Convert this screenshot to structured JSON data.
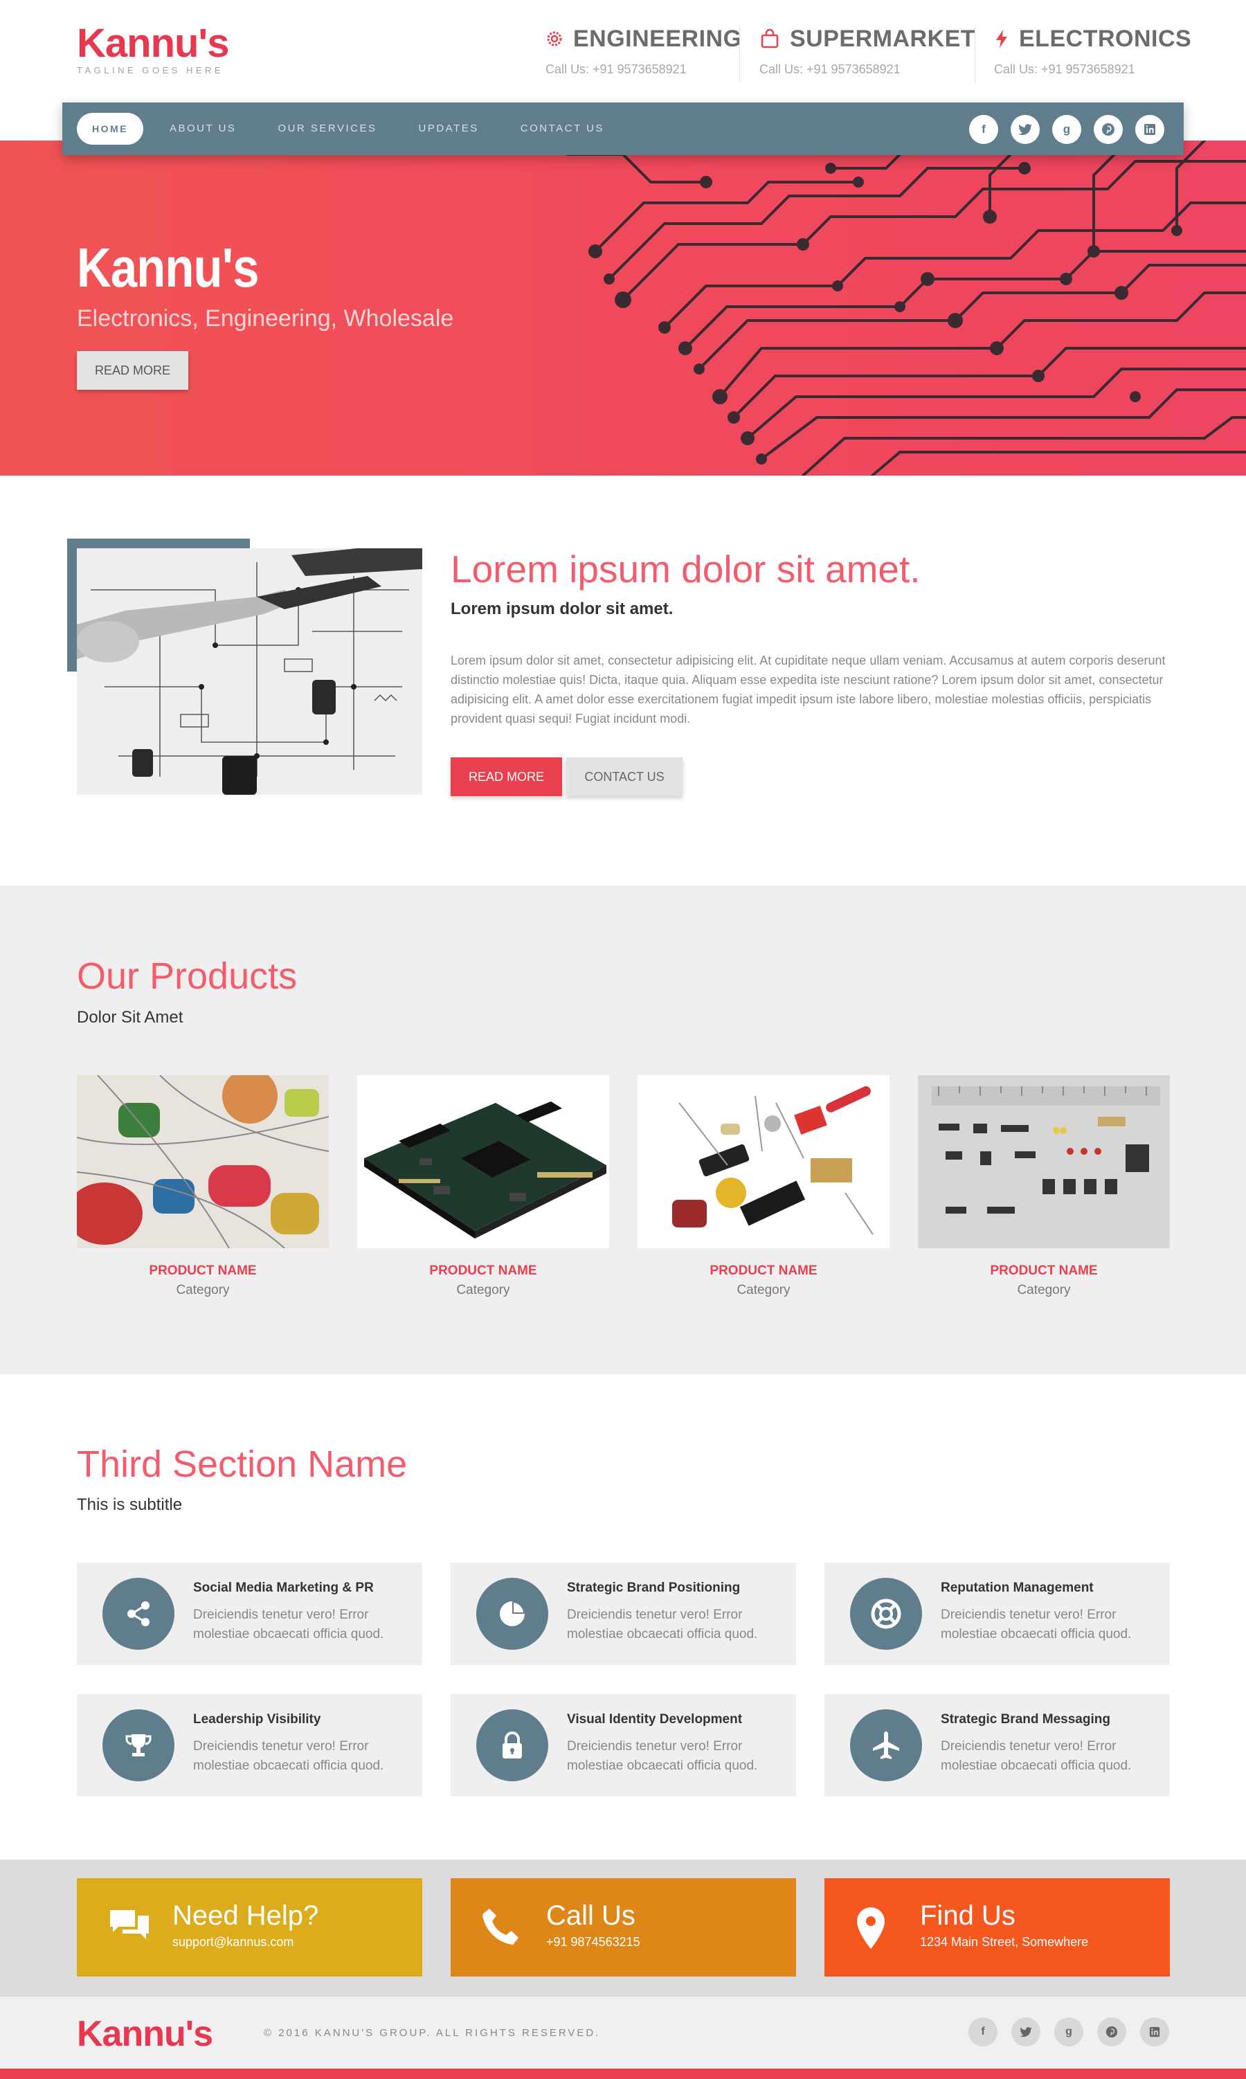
{
  "brand": {
    "logo": "Kannu's",
    "tagline": "TAGLINE GOES HERE"
  },
  "header_blocks": [
    {
      "title": "ENGINEERING",
      "phone": "Call Us: +91 9573658921",
      "icon": "gear-icon"
    },
    {
      "title": "SUPERMARKET",
      "phone": "Call Us: +91 9573658921",
      "icon": "shopping-bag-icon"
    },
    {
      "title": "ELECTRONICS",
      "phone": "Call Us: +91 9573658921",
      "icon": "lightning-icon"
    }
  ],
  "nav": {
    "items": [
      "HOME",
      "ABOUT US",
      "OUR SERVICES",
      "UPDATES",
      "CONTACT US"
    ],
    "social": [
      "f",
      "t",
      "g",
      "p",
      "in"
    ]
  },
  "hero": {
    "title": "Kannu's",
    "subtitle": "Electronics, Engineering, Wholesale",
    "button": "READ MORE"
  },
  "about": {
    "heading": "Lorem ipsum dolor sit amet.",
    "subheading": "Lorem ipsum dolor sit amet.",
    "body": "Lorem ipsum dolor sit amet, consectetur adipisicing elit. At cupiditate neque ullam veniam. Accusamus at autem corporis deserunt distinctio molestiae quis! Dicta, itaque quia. Aliquam esse expedita iste nesciunt ratione? Lorem ipsum dolor sit amet, consectetur adipisicing elit. A amet dolor esse exercitationem fugiat impedit ipsum iste labore libero, molestiae molestias officiis, perspiciatis provident quasi sequi! Fugiat incidunt modi.",
    "read_more": "READ MORE",
    "contact_us": "CONTACT US"
  },
  "products": {
    "title": "Our Products",
    "subtitle": "Dolor Sit Amet",
    "items": [
      {
        "name": "PRODUCT NAME",
        "category": "Category"
      },
      {
        "name": "PRODUCT NAME",
        "category": "Category"
      },
      {
        "name": "PRODUCT NAME",
        "category": "Category"
      },
      {
        "name": "PRODUCT NAME",
        "category": "Category"
      }
    ]
  },
  "services": {
    "title": "Third Section Name",
    "subtitle": "This is subtitle",
    "items": [
      {
        "title": "Social Media Marketing & PR",
        "desc": "Dreiciendis tenetur vero! Error molestiae obcaecati officia quod.",
        "icon": "share-icon"
      },
      {
        "title": "Strategic Brand Positioning",
        "desc": "Dreiciendis tenetur vero! Error molestiae obcaecati officia quod.",
        "icon": "pie-chart-icon"
      },
      {
        "title": "Reputation Management",
        "desc": "Dreiciendis tenetur vero! Error molestiae obcaecati officia quod.",
        "icon": "lifebuoy-icon"
      },
      {
        "title": "Leadership Visibility",
        "desc": "Dreiciendis tenetur vero! Error molestiae obcaecati officia quod.",
        "icon": "trophy-icon"
      },
      {
        "title": "Visual Identity Development",
        "desc": "Dreiciendis tenetur vero! Error molestiae obcaecati officia quod.",
        "icon": "lock-icon"
      },
      {
        "title": "Strategic Brand Messaging",
        "desc": "Dreiciendis tenetur vero! Error molestiae obcaecati officia quod.",
        "icon": "airplane-icon"
      }
    ]
  },
  "contact": [
    {
      "title": "Need Help?",
      "sub": "support@kannus.com",
      "icon": "chat-icon",
      "color": "#dcac1c"
    },
    {
      "title": "Call Us",
      "sub": "+91 9874563215",
      "icon": "phone-icon",
      "color": "#df8618"
    },
    {
      "title": "Find Us",
      "sub": "1234 Main Street, Somewhere",
      "icon": "map-pin-icon",
      "color": "#f5571f"
    }
  ],
  "footer": {
    "logo": "Kannu's",
    "copyright": "© 2016 KANNU'S GROUP. ALL RIGHTS RESERVED.",
    "social": [
      "f",
      "t",
      "g",
      "p",
      "in"
    ]
  },
  "colors": {
    "accent": "#e8404e",
    "slate": "#5f7d8c",
    "hero": "#f04c5a"
  }
}
